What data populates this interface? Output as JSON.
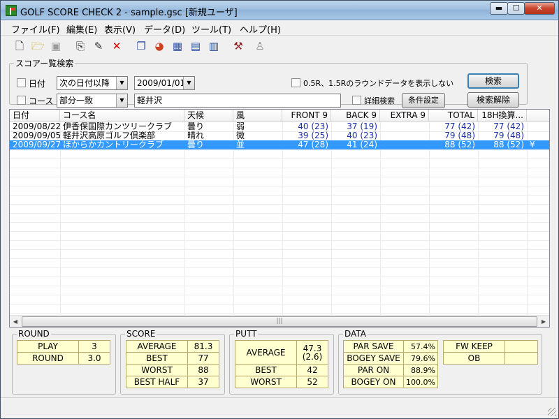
{
  "window": {
    "title": "GOLF SCORE CHECK 2 - sample.gsc [新規ユーザ]"
  },
  "menu": [
    "ファイル(F)",
    "編集(E)",
    "表示(V)",
    "データ(D)",
    "ツール(T)",
    "ヘルプ(H)"
  ],
  "toolbar_icons": [
    "new-file-icon",
    "open-folder-icon",
    "save-icon",
    "add-record-icon",
    "edit-record-icon",
    "delete-icon",
    "copy-icon",
    "chart-icon",
    "table-icon",
    "calendar-icon",
    "report-icon",
    "tools-icon",
    "user-icon"
  ],
  "search": {
    "legend": "スコアー覧検索",
    "date_label": "日付",
    "date_mode": "次の日付以降",
    "date_value": "2009/01/01",
    "hide_label": "0.5R、1.5Rのラウンドデータを表示しない",
    "course_label": "コース",
    "course_mode": "部分一致",
    "course_value": "軽井沢",
    "detail_label": "詳細検索",
    "condition_button": "条件設定",
    "search_button": "検索",
    "clear_button": "検索解除"
  },
  "grid": {
    "columns": [
      "日付",
      "コース名",
      "天候",
      "風",
      "FRONT 9",
      "BACK 9",
      "EXTRA 9",
      "TOTAL",
      "18H換算..."
    ],
    "rows": [
      {
        "date": "2009/08/22",
        "course": "伊香保国際カンツリークラブ",
        "weather": "曇り",
        "wind": "弱",
        "front": "40 (23)",
        "back": "37 (19)",
        "extra": "",
        "total": "77 (42)",
        "h18": "77 (42)",
        "extra_col": ""
      },
      {
        "date": "2009/09/05",
        "course": "軽井沢高原ゴルフ倶楽部",
        "weather": "晴れ",
        "wind": "微",
        "front": "39 (25)",
        "back": "40 (23)",
        "extra": "",
        "total": "79 (48)",
        "h18": "79 (48)",
        "extra_col": ""
      },
      {
        "date": "2009/09/27",
        "course": "ほからかカントリークラブ",
        "weather": "曇り",
        "wind": "並",
        "front": "47 (28)",
        "back": "41 (24)",
        "extra": "",
        "total": "88 (52)",
        "h18": "88 (52)",
        "extra_col": "¥"
      }
    ]
  },
  "round": {
    "legend": "ROUND",
    "rows": [
      {
        "label": "PLAY",
        "value": "3"
      },
      {
        "label": "ROUND",
        "value": "3.0"
      }
    ]
  },
  "score": {
    "legend": "SCORE",
    "rows": [
      {
        "label": "AVERAGE",
        "value": "81.3"
      },
      {
        "label": "BEST",
        "value": "77"
      },
      {
        "label": "WORST",
        "value": "88"
      },
      {
        "label": "BEST HALF",
        "value": "37"
      }
    ]
  },
  "putt": {
    "legend": "PUTT",
    "average_label": "AVERAGE",
    "average_value": "47.3",
    "average_sub": "(2.6)",
    "best_label": "BEST",
    "best_value": "42",
    "worst_label": "WORST",
    "worst_value": "52"
  },
  "data": {
    "legend": "DATA",
    "rows": [
      {
        "label": "PAR SAVE",
        "value": "57.4%"
      },
      {
        "label": "BOGEY SAVE",
        "value": "79.6%"
      },
      {
        "label": "PAR ON",
        "value": "88.9%"
      },
      {
        "label": "BOGEY ON",
        "value": "100.0%"
      }
    ],
    "fw_keep_label": "FW KEEP",
    "fw_keep_value": "",
    "ob_label": "OB",
    "ob_value": ""
  }
}
